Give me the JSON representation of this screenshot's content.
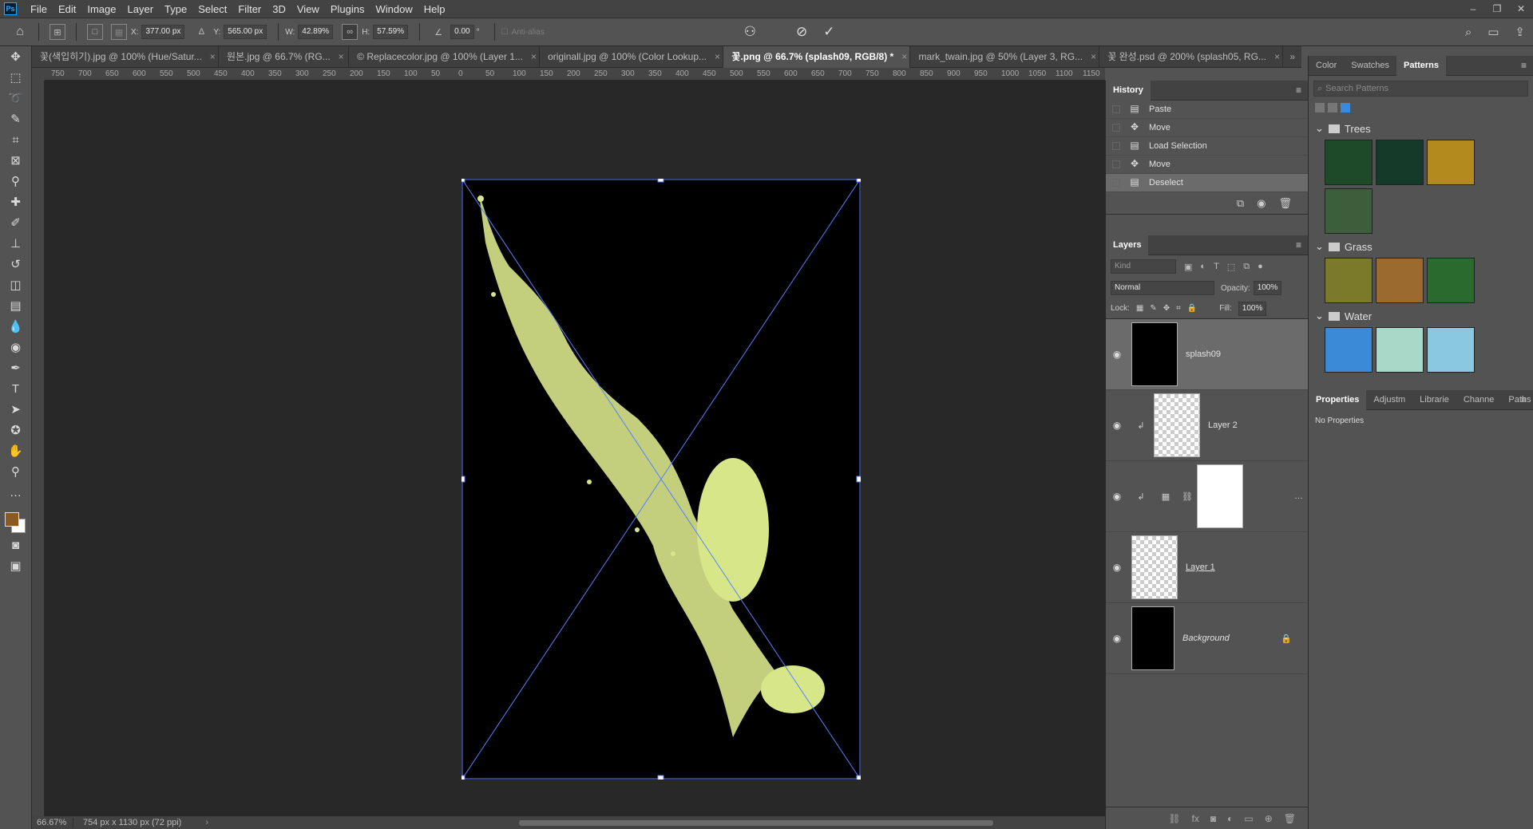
{
  "menubar": {
    "logo": "Ps",
    "items": [
      "File",
      "Edit",
      "Image",
      "Layer",
      "Type",
      "Select",
      "Filter",
      "3D",
      "View",
      "Plugins",
      "Window",
      "Help"
    ],
    "controls": [
      "–",
      "❐",
      "✕"
    ]
  },
  "options": {
    "x_label": "X:",
    "x_value": "377.00 px",
    "y_label": "Y:",
    "y_value": "565.00 px",
    "w_label": "W:",
    "w_value": "42.89%",
    "h_label": "H:",
    "h_value": "57.59%",
    "angle_value": "0.00",
    "angle_unit": "°",
    "antialias": "Anti-alias"
  },
  "tabs": [
    {
      "label": "꽃(색입히기).jpg @ 100% (Hue/Satur..."
    },
    {
      "label": "원본.jpg @ 66.7% (RG..."
    },
    {
      "label": "© Replacecolor.jpg @ 100% (Layer 1..."
    },
    {
      "label": "originall.jpg @ 100% (Color Lookup..."
    },
    {
      "label": "꽃.png @ 66.7% (splash09, RGB/8) *",
      "active": true
    },
    {
      "label": "mark_twain.jpg @ 50% (Layer 3, RG..."
    },
    {
      "label": "꽃 완성.psd @ 200% (splash05, RG..."
    }
  ],
  "ruler_ticks": [
    "750",
    "700",
    "650",
    "600",
    "550",
    "500",
    "450",
    "400",
    "350",
    "300",
    "250",
    "200",
    "150",
    "100",
    "50",
    "0",
    "50",
    "100",
    "150",
    "200",
    "250",
    "300",
    "350",
    "400",
    "450",
    "500",
    "550",
    "600",
    "650",
    "700",
    "750",
    "800",
    "850",
    "900",
    "950",
    "1000",
    "1050",
    "1100",
    "1150"
  ],
  "status": {
    "zoom": "66.67%",
    "doc": "754 px x 1130 px (72 ppi)"
  },
  "history": {
    "title": "History",
    "items": [
      {
        "label": "Paste"
      },
      {
        "label": "Move"
      },
      {
        "label": "Load Selection"
      },
      {
        "label": "Move"
      },
      {
        "label": "Deselect"
      }
    ]
  },
  "layers": {
    "title": "Layers",
    "kind": "Kind",
    "blend": "Normal",
    "opacity_label": "Opacity:",
    "opacity": "100%",
    "lock_label": "Lock:",
    "fill_label": "Fill:",
    "fill": "100%",
    "items": [
      {
        "name": "splash09"
      },
      {
        "name": "Layer 2"
      },
      {
        "name": ""
      },
      {
        "name": "Layer 1"
      },
      {
        "name": "Background"
      }
    ]
  },
  "right": {
    "tabs": [
      "Color",
      "Swatches",
      "Patterns"
    ],
    "search_placeholder": "Search Patterns",
    "groups": [
      {
        "name": "Trees",
        "swatches": [
          "#1f4a2a",
          "#163a2a",
          "#b28a1e",
          "#3c5e3a"
        ]
      },
      {
        "name": "Grass",
        "swatches": [
          "#7a7a2a",
          "#9a6a2e",
          "#2a6a2e"
        ]
      },
      {
        "name": "Water",
        "swatches": [
          "#3a8ad8",
          "#a8d8c8",
          "#8ac8e0"
        ]
      }
    ],
    "props_tabs": [
      "Properties",
      "Adjustm",
      "Librarie",
      "Channe",
      "Paths"
    ],
    "props_body": "No Properties"
  }
}
